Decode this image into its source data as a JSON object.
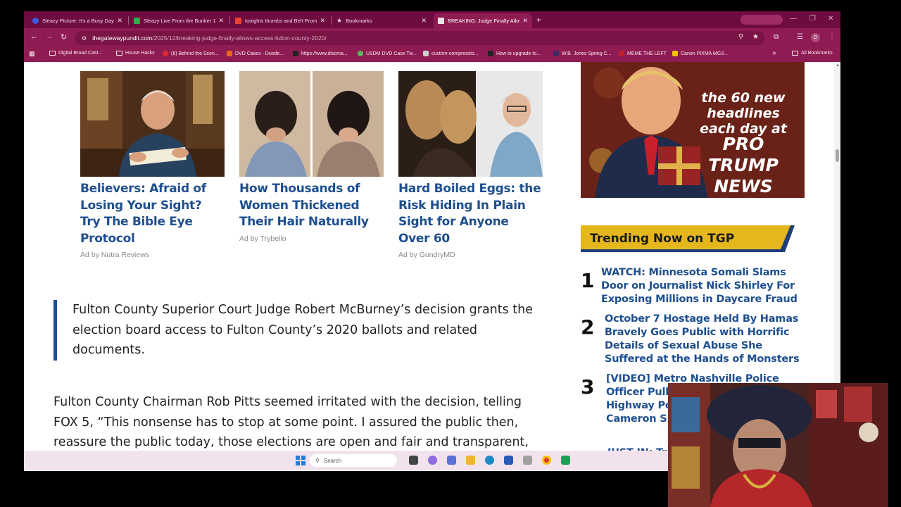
{
  "tabs": [
    {
      "label": "Sleazy Picture: It's a Busy Day fi",
      "active": false
    },
    {
      "label": "Sleazy Live From the Bunker 12",
      "active": false
    },
    {
      "label": "tonights thumbs and Belt Prom",
      "active": false
    },
    {
      "label": "Bookmarks",
      "active": false
    },
    {
      "label": "BREAKING: Judge Finally Allow",
      "active": true
    }
  ],
  "address": {
    "domain": "thegatewaypundit.com",
    "path": "/2025/12/breaking-judge-finally-allows-access-fulton-county-2020/"
  },
  "bookmarks": [
    "Digital Broad Cast...",
    "House Hacks",
    "(8) Behind the Scen...",
    "DVD Cases - Duode...",
    "https://www.discma...",
    "USDM DVD Case Tw...",
    "custom-compressio...",
    "How to upgrade to...",
    "W.B. Jones Spring C...",
    "MEME THE LEFT",
    "Canon PIXMA MG3...",
    "All Bookmarks"
  ],
  "ads": [
    {
      "title": "Believers: Afraid of Losing Your Sight? Try The Bible Eye Protocol",
      "source": "Ad by Nutra Reviews"
    },
    {
      "title": "How Thousands of Women Thickened Their Hair Naturally",
      "source": "Ad by Trybello"
    },
    {
      "title": "Hard Boiled Eggs: the Risk Hiding In Plain Sight for Anyone Over 60",
      "source": "Ad by GundryMD"
    }
  ],
  "article": {
    "quote": "Fulton County Superior Court Judge Robert McBurney’s decision grants the election board access to Fulton County’s 2020 ballots and related documents.",
    "paragraph": "Fulton County Chairman Rob Pitts seemed irritated with the decision, telling FOX 5, “This nonsense has to stop at some point.  I assured the public then, reassure the public today, those elections are open and fair and transparent, and every vote was counted.”"
  },
  "sidebar": {
    "banner": {
      "line1": "the 60 new headlines each day at",
      "line2": "PRO TRUMP NEWS"
    },
    "trending_title": "Trending Now on TGP",
    "trending": [
      {
        "num": "1",
        "title": "WATCH: Minnesota Somali Slams Door on Journalist Nick Shirley For Exposing Millions in Daycare Fraud"
      },
      {
        "num": "2",
        "title": "October 7 Hostage Held By Hamas Bravely Goes Public with Horrific Details of Sexual Abuse She Suffered at the Hands of Monsters"
      },
      {
        "num": "3",
        "title": "[VIDEO] Metro Nashville Police Officer Pulls Over Tennessee Highway Po... Tennessee... Cameron S..."
      },
      {
        "num": "4",
        "title": "JUST IN: Tr..."
      }
    ]
  },
  "taskbar": {
    "search_placeholder": "Search"
  },
  "colors": {
    "chrome": "#8f1b53",
    "link": "#1e4f8f",
    "trend_band": "#e5b71c",
    "quote_bar": "#1f4a99"
  }
}
